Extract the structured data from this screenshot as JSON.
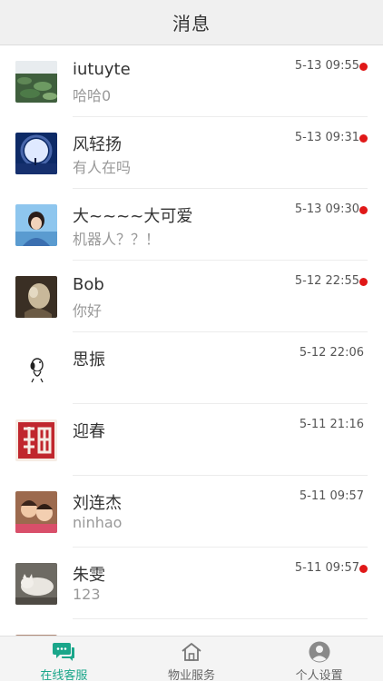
{
  "header": {
    "title": "消息"
  },
  "conversations": [
    {
      "name": "iutuyte",
      "preview": "哈哈0",
      "time": "5-13 09:55",
      "unread": true,
      "avatar_icon": "lotus-pond-photo"
    },
    {
      "name": "风轻扬",
      "preview": "有人在吗",
      "time": "5-13 09:31",
      "unread": true,
      "avatar_icon": "night-moon-photo"
    },
    {
      "name": "大~~~~大可爱",
      "preview": "机器人？？！",
      "time": "5-13 09:30",
      "unread": true,
      "avatar_icon": "girl-portrait-photo"
    },
    {
      "name": "Bob",
      "preview": "你好",
      "time": "5-12 22:55",
      "unread": true,
      "avatar_icon": "horse-statue-photo"
    },
    {
      "name": "思振",
      "preview": "",
      "time": "5-12 22:06",
      "unread": false,
      "avatar_icon": "snoopy-drawing"
    },
    {
      "name": "迎春",
      "preview": "",
      "time": "5-11 21:16",
      "unread": false,
      "avatar_icon": "red-seal-stamp"
    },
    {
      "name": "刘连杰",
      "preview": "ninhao",
      "time": "5-11 09:57",
      "unread": false,
      "avatar_icon": "kids-photo"
    },
    {
      "name": "朱雯",
      "preview": "123",
      "time": "5-11 09:57",
      "unread": true,
      "avatar_icon": "cat-photo"
    }
  ],
  "tabbar": {
    "tabs": [
      {
        "label": "在线客服",
        "icon": "chat-bubble-icon",
        "active": true
      },
      {
        "label": "物业服务",
        "icon": "house-icon",
        "active": false,
        "badge": true
      },
      {
        "label": "个人设置",
        "icon": "person-icon",
        "active": false
      }
    ]
  },
  "colors": {
    "accent": "#1aa68a",
    "unread": "#e01818",
    "header_bg": "#f0f0f0"
  }
}
